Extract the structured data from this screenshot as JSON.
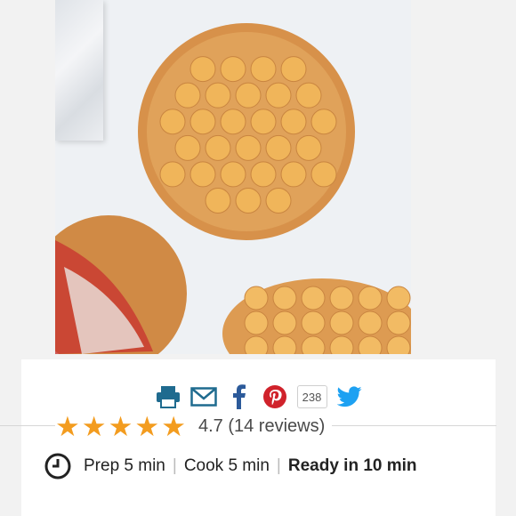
{
  "photo": {
    "subject": "bubble waffles"
  },
  "share": {
    "icons": [
      "print-icon",
      "email-icon",
      "facebook-icon",
      "pinterest-icon",
      "twitter-icon"
    ],
    "pinterest_count": "238",
    "colors": {
      "print": "#1f6b8f",
      "email": "#1f6b8f",
      "facebook": "#2c5a9a",
      "pinterest": "#d0222b",
      "twitter": "#1da1f2"
    }
  },
  "rating": {
    "value_text": "4.7 (14 reviews)",
    "stars": 5,
    "star_color": "#f39c1f"
  },
  "times": {
    "prep": "Prep 5 min",
    "cook": "Cook 5 min",
    "ready": "Ready in 10 min"
  }
}
